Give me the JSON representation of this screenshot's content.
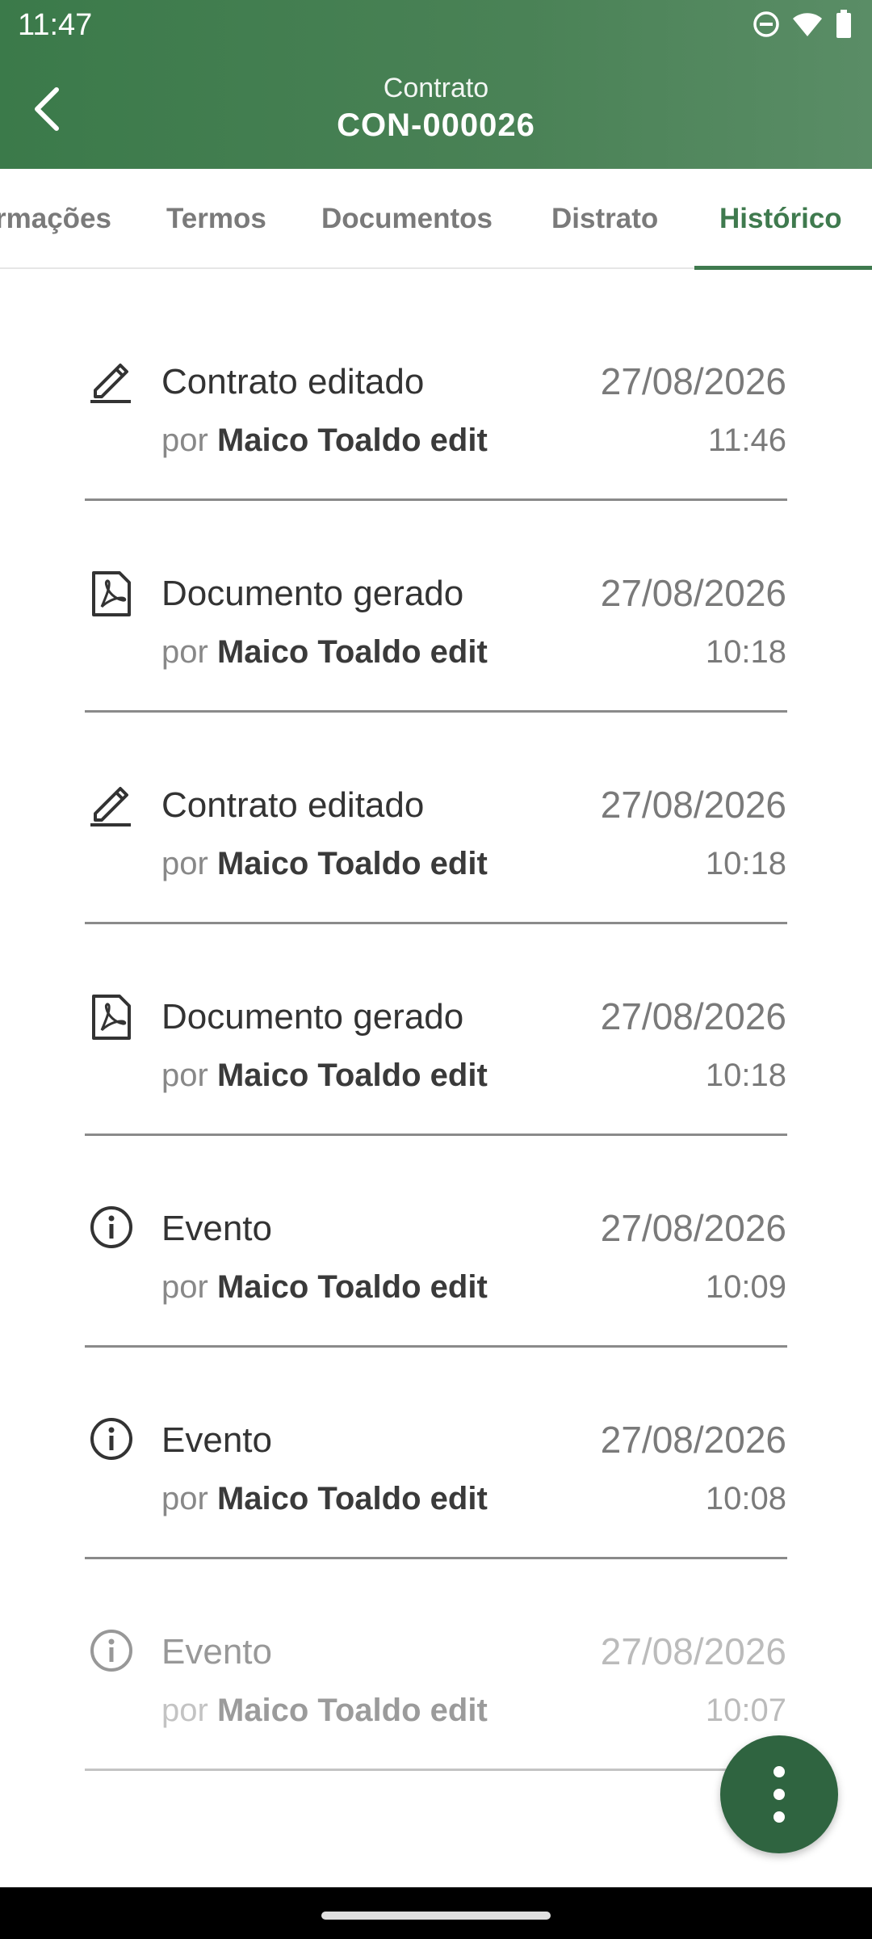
{
  "status_bar": {
    "time": "11:47",
    "icons": [
      "do-not-disturb-icon",
      "wifi-icon",
      "battery-icon"
    ]
  },
  "header": {
    "subtitle": "Contrato",
    "title": "CON-000026",
    "back_icon": "chevron-left-icon"
  },
  "tabs": [
    {
      "label": "rmações"
    },
    {
      "label": "Termos"
    },
    {
      "label": "Documentos"
    },
    {
      "label": "Distrato"
    },
    {
      "label": "Histórico",
      "active": true
    }
  ],
  "history": [
    {
      "icon": "edit-icon",
      "title": "Contrato editado",
      "by_prefix": "por",
      "user": "Maico Toaldo edit",
      "date": "27/08/2026",
      "time": "11:46"
    },
    {
      "icon": "pdf-document-icon",
      "title": "Documento gerado",
      "by_prefix": "por",
      "user": "Maico Toaldo edit",
      "date": "27/08/2026",
      "time": "10:18"
    },
    {
      "icon": "edit-icon",
      "title": "Contrato editado",
      "by_prefix": "por",
      "user": "Maico Toaldo edit",
      "date": "27/08/2026",
      "time": "10:18"
    },
    {
      "icon": "pdf-document-icon",
      "title": "Documento gerado",
      "by_prefix": "por",
      "user": "Maico Toaldo edit",
      "date": "27/08/2026",
      "time": "10:18"
    },
    {
      "icon": "info-icon",
      "title": "Evento",
      "by_prefix": "por",
      "user": "Maico Toaldo edit",
      "date": "27/08/2026",
      "time": "10:09"
    },
    {
      "icon": "info-icon",
      "title": "Evento",
      "by_prefix": "por",
      "user": "Maico Toaldo edit",
      "date": "27/08/2026",
      "time": "10:08"
    },
    {
      "icon": "info-icon",
      "title": "Evento",
      "by_prefix": "por",
      "user": "Maico Toaldo edit",
      "date": "27/08/2026",
      "time": "10:07"
    }
  ],
  "fab": {
    "icon": "more-vertical-icon"
  },
  "colors": {
    "primary": "#3f7a4e",
    "fab": "#2f6440",
    "text": "#333333",
    "muted": "#7a7a7a"
  }
}
